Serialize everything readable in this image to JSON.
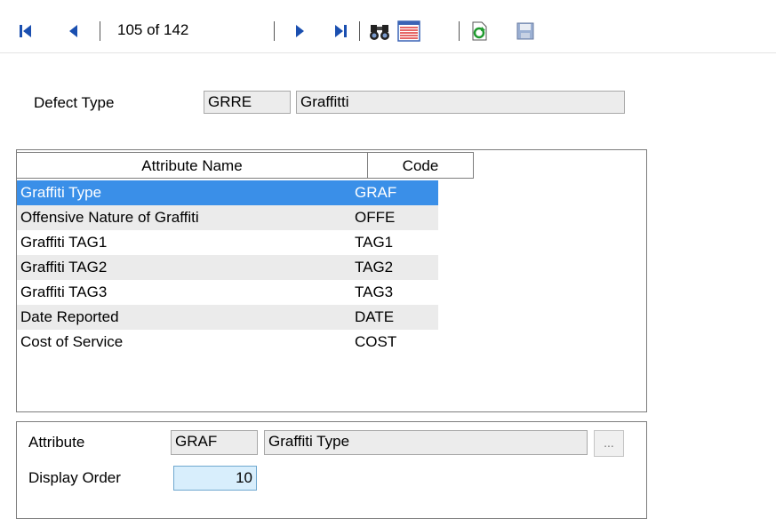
{
  "toolbar": {
    "pager": "105 of 142",
    "icons": [
      "first-record-icon",
      "previous-record-icon",
      "next-record-icon",
      "last-record-icon",
      "find-binoculars-icon",
      "list-view-icon",
      "refresh-icon",
      "save-icon"
    ]
  },
  "header": {
    "defect_type_label": "Defect Type",
    "defect_type_code": "GRRE",
    "defect_type_name": "Graffitti"
  },
  "grid": {
    "columns": [
      "Attribute Name",
      "Code"
    ],
    "rows": [
      {
        "name": "Graffiti Type",
        "code": "GRAF",
        "selected": true
      },
      {
        "name": "Offensive Nature of Graffiti",
        "code": "OFFE"
      },
      {
        "name": "Graffiti TAG1",
        "code": "TAG1"
      },
      {
        "name": "Graffiti TAG2",
        "code": "TAG2"
      },
      {
        "name": "Graffiti TAG3",
        "code": "TAG3"
      },
      {
        "name": "Date Reported",
        "code": "DATE"
      },
      {
        "name": "Cost of Service",
        "code": "COST"
      }
    ]
  },
  "detail": {
    "attribute_label": "Attribute",
    "attribute_code": "GRAF",
    "attribute_name": "Graffiti Type",
    "lookup_button": "...",
    "display_order_label": "Display Order",
    "display_order_value": "10"
  },
  "colors": {
    "toolbar_icon_blue": "#1a4fb0",
    "selection": "#3a8fe8",
    "alt_row": "#ebebeb",
    "display_order_bg": "#d8eefc"
  }
}
